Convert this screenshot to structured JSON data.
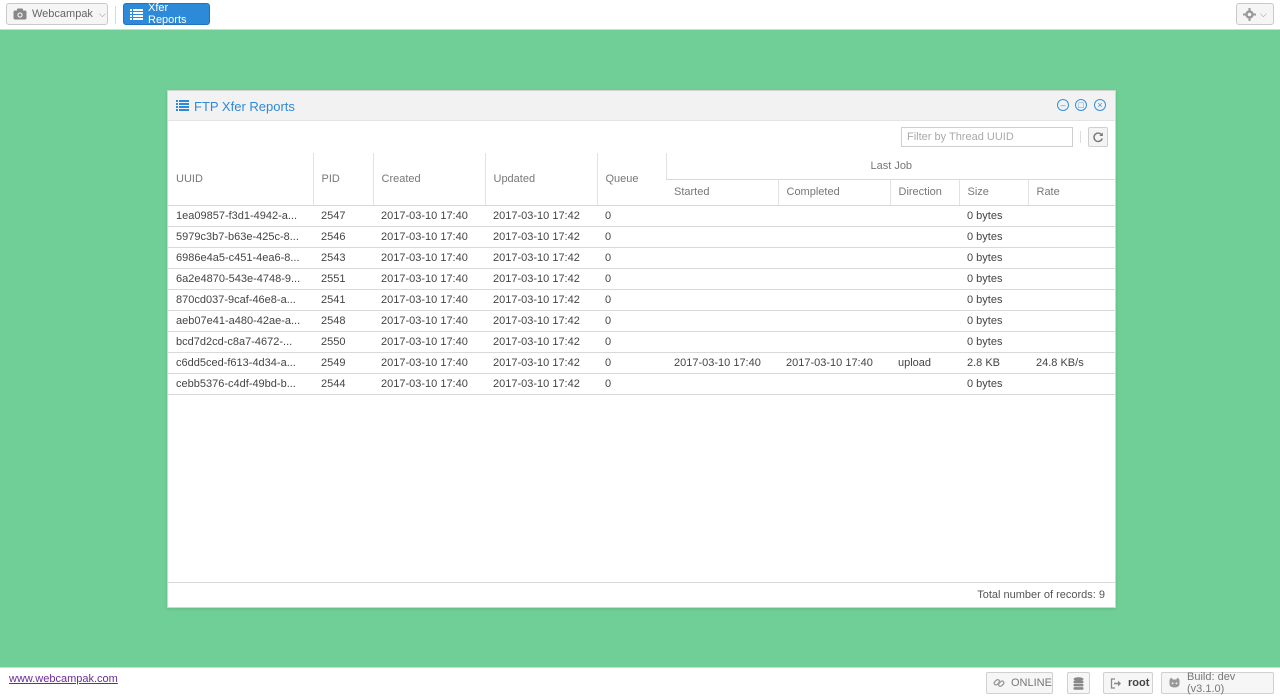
{
  "topbar": {
    "app_label": "Webcampak",
    "reports_label": "Xfer Reports",
    "app_icon": "camera-icon",
    "reports_icon": "list-icon",
    "settings_icon": "gear-icon"
  },
  "window": {
    "title": "FTP Xfer Reports",
    "title_icon": "list-icon",
    "filter_placeholder": "Filter by Thread UUID",
    "controls": [
      "minimize-icon",
      "maximize-icon",
      "close-icon"
    ]
  },
  "table": {
    "headers": {
      "uuid": "UUID",
      "pid": "PID",
      "created": "Created",
      "updated": "Updated",
      "queue": "Queue",
      "last_job": "Last Job",
      "started": "Started",
      "completed": "Completed",
      "direction": "Direction",
      "size": "Size",
      "rate": "Rate"
    },
    "rows": [
      {
        "uuid": "1ea09857-f3d1-4942-a...",
        "pid": "2547",
        "created": "2017-03-10 17:40",
        "updated": "2017-03-10 17:42",
        "queue": "0",
        "started": "",
        "completed": "",
        "direction": "",
        "size": "0 bytes",
        "rate": ""
      },
      {
        "uuid": "5979c3b7-b63e-425c-8...",
        "pid": "2546",
        "created": "2017-03-10 17:40",
        "updated": "2017-03-10 17:42",
        "queue": "0",
        "started": "",
        "completed": "",
        "direction": "",
        "size": "0 bytes",
        "rate": ""
      },
      {
        "uuid": "6986e4a5-c451-4ea6-8...",
        "pid": "2543",
        "created": "2017-03-10 17:40",
        "updated": "2017-03-10 17:42",
        "queue": "0",
        "started": "",
        "completed": "",
        "direction": "",
        "size": "0 bytes",
        "rate": ""
      },
      {
        "uuid": "6a2e4870-543e-4748-9...",
        "pid": "2551",
        "created": "2017-03-10 17:40",
        "updated": "2017-03-10 17:42",
        "queue": "0",
        "started": "",
        "completed": "",
        "direction": "",
        "size": "0 bytes",
        "rate": ""
      },
      {
        "uuid": "870cd037-9caf-46e8-a...",
        "pid": "2541",
        "created": "2017-03-10 17:40",
        "updated": "2017-03-10 17:42",
        "queue": "0",
        "started": "",
        "completed": "",
        "direction": "",
        "size": "0 bytes",
        "rate": ""
      },
      {
        "uuid": "aeb07e41-a480-42ae-a...",
        "pid": "2548",
        "created": "2017-03-10 17:40",
        "updated": "2017-03-10 17:42",
        "queue": "0",
        "started": "",
        "completed": "",
        "direction": "",
        "size": "0 bytes",
        "rate": ""
      },
      {
        "uuid": "bcd7d2cd-c8a7-4672-...",
        "pid": "2550",
        "created": "2017-03-10 17:40",
        "updated": "2017-03-10 17:42",
        "queue": "0",
        "started": "",
        "completed": "",
        "direction": "",
        "size": "0 bytes",
        "rate": ""
      },
      {
        "uuid": "c6dd5ced-f613-4d34-a...",
        "pid": "2549",
        "created": "2017-03-10 17:40",
        "updated": "2017-03-10 17:42",
        "queue": "0",
        "started": "2017-03-10 17:40",
        "completed": "2017-03-10 17:40",
        "direction": "upload",
        "size": "2.8 KB",
        "rate": "24.8 KB/s"
      },
      {
        "uuid": "cebb5376-c4df-49bd-b...",
        "pid": "2544",
        "created": "2017-03-10 17:40",
        "updated": "2017-03-10 17:42",
        "queue": "0",
        "started": "",
        "completed": "",
        "direction": "",
        "size": "0 bytes",
        "rate": ""
      }
    ],
    "total_label": "Total number of records: 9"
  },
  "statusbar": {
    "site_link": "www.webcampak.com",
    "online_label": "ONLINE",
    "user_label": "root",
    "build_label": "Build: dev (v3.1.0)",
    "online_icon": "link-icon",
    "db_icon": "database-icon",
    "user_icon": "sign-out-icon",
    "build_icon": "github-icon"
  },
  "colors": {
    "background": "#70cf96",
    "accent": "#2d8ad8"
  }
}
